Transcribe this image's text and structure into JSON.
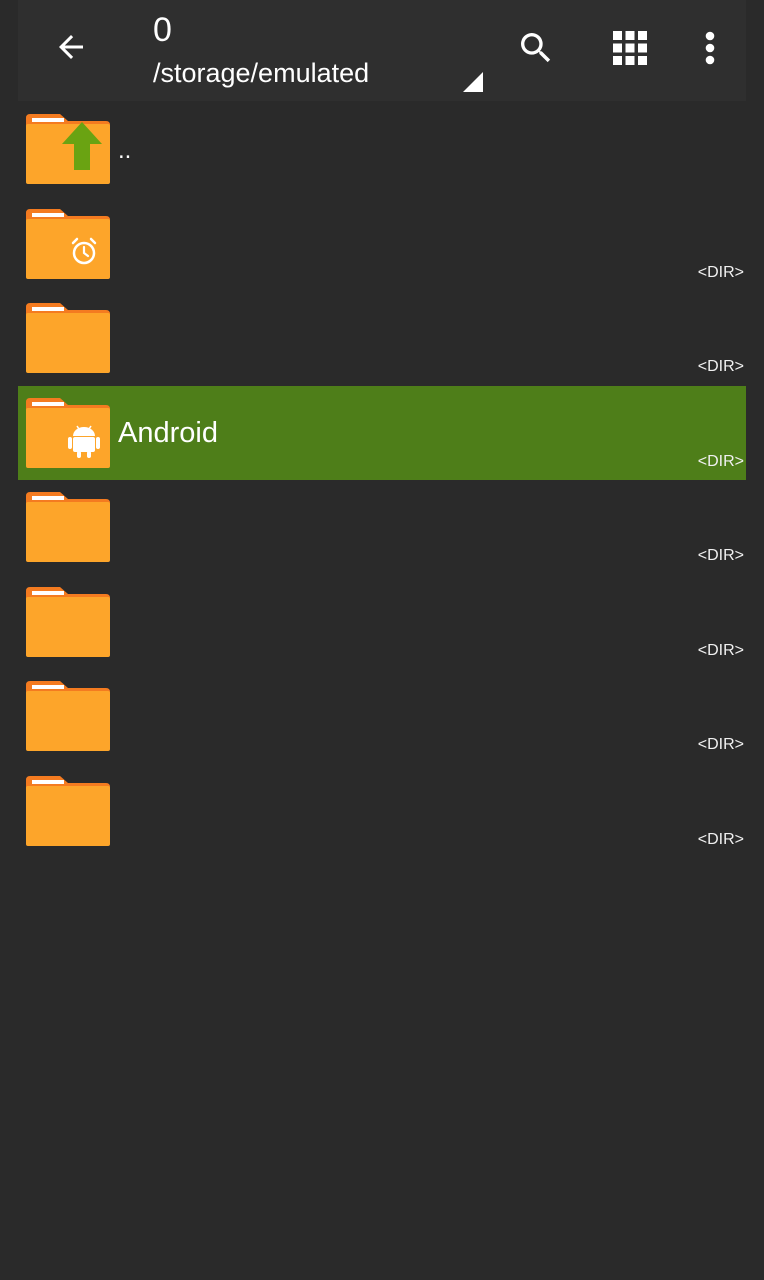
{
  "appbar": {
    "title": "0",
    "subtitle": "/storage/emulated",
    "back_icon": "arrow-left-icon",
    "search_icon": "search-icon",
    "grid_icon": "grid-view-icon",
    "more_icon": "more-vert-icon"
  },
  "colors": {
    "background": "#2a2a2a",
    "appbar": "#2f2f2f",
    "selected_row": "#4e7e19",
    "folder": "#fda52a",
    "folder_tab": "#f47b20",
    "up_arrow": "#6aa312"
  },
  "list": {
    "items": [
      {
        "name": "..",
        "tag": "",
        "icon": "folder-up-icon",
        "selected": false
      },
      {
        "name": "",
        "tag": "<DIR>",
        "icon": "folder-alarm-icon",
        "selected": false
      },
      {
        "name": "",
        "tag": "<DIR>",
        "icon": "folder-icon",
        "selected": false
      },
      {
        "name": "Android",
        "tag": "<DIR>",
        "icon": "folder-android-icon",
        "selected": true
      },
      {
        "name": "",
        "tag": "<DIR>",
        "icon": "folder-icon",
        "selected": false
      },
      {
        "name": "",
        "tag": "<DIR>",
        "icon": "folder-icon",
        "selected": false
      },
      {
        "name": "",
        "tag": "<DIR>",
        "icon": "folder-icon",
        "selected": false
      },
      {
        "name": "",
        "tag": "<DIR>",
        "icon": "folder-icon",
        "selected": false
      }
    ]
  }
}
